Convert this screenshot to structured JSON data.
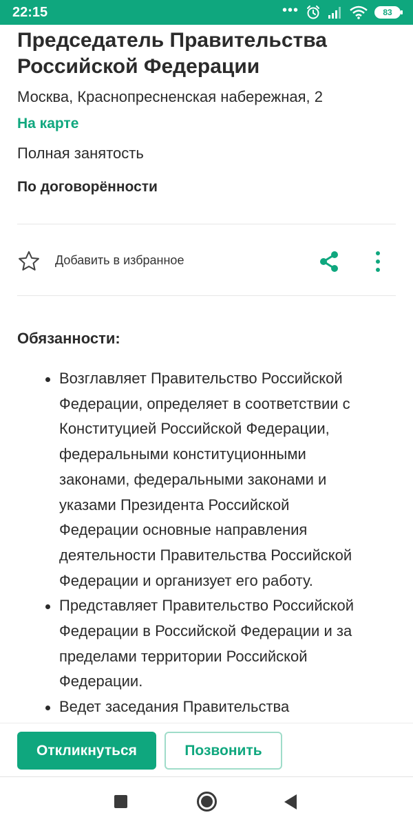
{
  "status_bar": {
    "time": "22:15",
    "battery": "83",
    "icons": [
      "dots-icon",
      "alarm-icon",
      "signal-icon",
      "wifi-icon",
      "battery-icon"
    ]
  },
  "vacancy": {
    "title": "Председатель Правительства Российской Федерации",
    "address": "Москва, Краснопресненская набережная, 2",
    "map_link": "На карте",
    "employment": "Полная занятость",
    "salary": "По договорённости"
  },
  "favorites": {
    "label": "Добавить в избранное"
  },
  "responsibilities": {
    "heading": "Обязанности:",
    "items": [
      {
        "lines": [
          "Возглавляет Правительство Российской",
          "Федерации, определяет в соответствии с",
          "Конституцией Российской Федерации,",
          "федеральными конституционными",
          "законами, федеральными законами и",
          "указами Президента Российской",
          "Федерации основные направления",
          "деятельности Правительства Российской",
          "Федерации и организует его работу."
        ]
      },
      {
        "lines": [
          "Представляет Правительство Российской",
          "Федерации в Российской Федерации и за",
          "пределами территории Российской",
          "Федерации."
        ]
      },
      {
        "lines": [
          "Ведет заседания Правительства"
        ]
      }
    ]
  },
  "actions": {
    "respond_label": "Откликнуться",
    "call_label": "Позвонить"
  },
  "colors": {
    "accent": "#0fa77e",
    "text": "#2b2b2b",
    "divider": "#e6e6e6"
  }
}
